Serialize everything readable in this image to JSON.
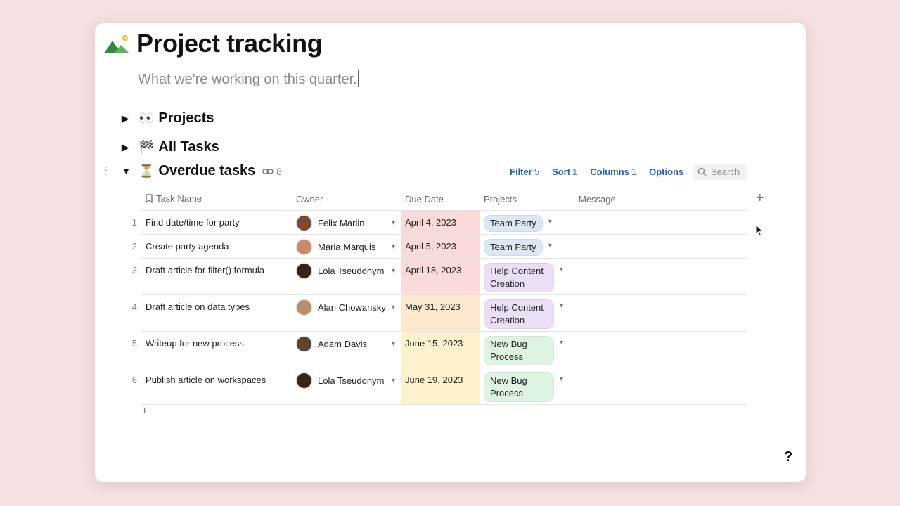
{
  "page": {
    "title": "Project tracking",
    "subtitle": "What we're working on this quarter.",
    "help_label": "?"
  },
  "sections": [
    {
      "label": "Projects",
      "icon": "eyes-icon"
    },
    {
      "label": "All Tasks",
      "icon": "checkered-flag-icon"
    },
    {
      "label": "Overdue tasks",
      "icon": "hourglass-icon",
      "link_count": "8"
    }
  ],
  "toolbar": {
    "filter_label": "Filter",
    "filter_count": "5",
    "sort_label": "Sort",
    "sort_count": "1",
    "columns_label": "Columns",
    "columns_count": "1",
    "options_label": "Options",
    "search_placeholder": "Search"
  },
  "table": {
    "columns": [
      "Task Name",
      "Owner",
      "Due Date",
      "Projects",
      "Message"
    ],
    "rows": [
      {
        "num": "1",
        "task": "Find date/time for party",
        "owner": "Felix Marlin",
        "due": "April 4, 2023",
        "due_status": "red",
        "project": "Team Party",
        "project_color": "blue"
      },
      {
        "num": "2",
        "task": "Create party agenda",
        "owner": "Maria Marquis",
        "due": "April 5, 2023",
        "due_status": "red",
        "project": "Team Party",
        "project_color": "blue"
      },
      {
        "num": "3",
        "task": "Draft article for filter() formula",
        "owner": "Lola Tseudonym",
        "due": "April 18, 2023",
        "due_status": "red",
        "project": "Help Content Creation",
        "project_color": "purple"
      },
      {
        "num": "4",
        "task": "Draft article on data types",
        "owner": "Alan Chowansky",
        "due": "May 31, 2023",
        "due_status": "amber",
        "project": "Help Content Creation",
        "project_color": "purple"
      },
      {
        "num": "5",
        "task": "Writeup for new process",
        "owner": "Adam Davis",
        "due": "June 15, 2023",
        "due_status": "yellow",
        "project": "New Bug Process",
        "project_color": "green"
      },
      {
        "num": "6",
        "task": "Publish article on workspaces",
        "owner": "Lola Tseudonym",
        "due": "June 19, 2023",
        "due_status": "yellow",
        "project": "New Bug Process",
        "project_color": "green"
      }
    ]
  },
  "colors": {
    "background": "#f3e0e0",
    "link_blue": "#1f5fb8",
    "overdue_red": "#fbdada",
    "due_amber": "#fde8cd",
    "due_yellow": "#fdf2cc"
  }
}
